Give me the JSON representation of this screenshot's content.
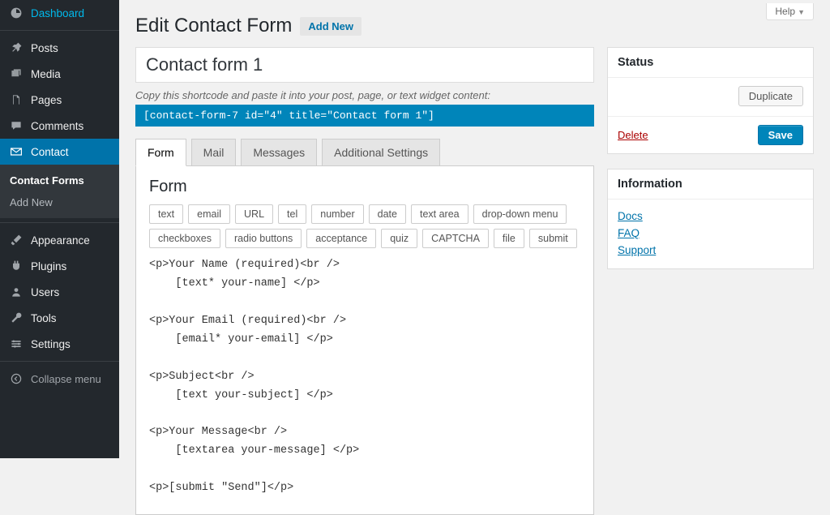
{
  "help_label": "Help",
  "page_title": "Edit Contact Form",
  "add_new_label": "Add New",
  "sidebar": {
    "items": [
      {
        "label": "Dashboard",
        "icon": "dashboard"
      },
      {
        "label": "Posts",
        "icon": "pin"
      },
      {
        "label": "Media",
        "icon": "media"
      },
      {
        "label": "Pages",
        "icon": "pages"
      },
      {
        "label": "Comments",
        "icon": "comment"
      },
      {
        "label": "Contact",
        "icon": "mail",
        "current": true
      },
      {
        "label": "Appearance",
        "icon": "brush"
      },
      {
        "label": "Plugins",
        "icon": "plug"
      },
      {
        "label": "Users",
        "icon": "user"
      },
      {
        "label": "Tools",
        "icon": "wrench"
      },
      {
        "label": "Settings",
        "icon": "sliders"
      }
    ],
    "submenu": [
      {
        "label": "Contact Forms",
        "current": true
      },
      {
        "label": "Add New"
      }
    ],
    "collapse_label": "Collapse menu"
  },
  "form_title": "Contact form 1",
  "shortcode_hint": "Copy this shortcode and paste it into your post, page, or text widget content:",
  "shortcode_value": "[contact-form-7 id=\"4\" title=\"Contact form 1\"]",
  "tabs": [
    "Form",
    "Mail",
    "Messages",
    "Additional Settings"
  ],
  "active_tab": "Form",
  "panel_heading": "Form",
  "tag_buttons": [
    "text",
    "email",
    "URL",
    "tel",
    "number",
    "date",
    "text area",
    "drop-down menu",
    "checkboxes",
    "radio buttons",
    "acceptance",
    "quiz",
    "CAPTCHA",
    "file",
    "submit"
  ],
  "form_code": "<p>Your Name (required)<br />\n    [text* your-name] </p>\n\n<p>Your Email (required)<br />\n    [email* your-email] </p>\n\n<p>Subject<br />\n    [text your-subject] </p>\n\n<p>Your Message<br />\n    [textarea your-message] </p>\n\n<p>[submit \"Send\"]</p>",
  "status_box": {
    "title": "Status",
    "duplicate_label": "Duplicate",
    "delete_label": "Delete",
    "save_label": "Save"
  },
  "info_box": {
    "title": "Information",
    "links": [
      "Docs",
      "FAQ",
      "Support"
    ]
  }
}
